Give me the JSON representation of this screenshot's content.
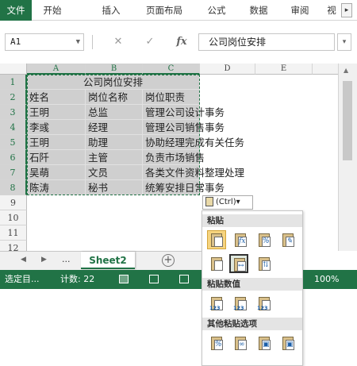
{
  "ribbon": {
    "tabs": [
      {
        "label": "文件"
      },
      {
        "label": "开始"
      },
      {
        "label": "插入"
      },
      {
        "label": "页面布局"
      },
      {
        "label": "公式"
      },
      {
        "label": "数据"
      },
      {
        "label": "审阅"
      },
      {
        "label": "视"
      }
    ],
    "more": "▸"
  },
  "formula_bar": {
    "name_box": "A1",
    "cancel": "✕",
    "enter": "✓",
    "fx": "fx",
    "value": "公司岗位安排"
  },
  "columns": [
    "A",
    "B",
    "C",
    "D",
    "E"
  ],
  "rows": [
    "1",
    "2",
    "3",
    "4",
    "5",
    "6",
    "7",
    "8",
    "9",
    "10",
    "11",
    "12"
  ],
  "cells": {
    "title": "公司岗位安排",
    "header": [
      "姓名",
      "岗位名称",
      "岗位职责"
    ],
    "data": [
      [
        "王明",
        "总监",
        "管理公司设计事务"
      ],
      [
        "李彧",
        "经理",
        "管理公司销售事务"
      ],
      [
        "王明",
        "助理",
        "协助经理完成有关任务"
      ],
      [
        "石阡",
        "主管",
        "负责市场销售"
      ],
      [
        "吴萌",
        "文员",
        "各类文件资料整理处理"
      ],
      [
        "陈涛",
        "秘书",
        "统筹安排日常事务"
      ]
    ]
  },
  "paste_button": {
    "label": "(Ctrl)▾"
  },
  "paste_menu": {
    "sections": [
      {
        "title": "粘贴"
      },
      {
        "title": "粘贴数值"
      },
      {
        "title": "其他粘贴选项"
      }
    ]
  },
  "sheet_tabs": {
    "nav_left": "◀",
    "nav_right": "▶",
    "dots": "...",
    "active": "Sheet2",
    "add": "+"
  },
  "status_bar": {
    "mode": "选定目...",
    "count": "计数: 22",
    "zoom": "100%"
  },
  "colors": {
    "excel_green": "#217346",
    "selection_fill": "#cfcfcf"
  }
}
